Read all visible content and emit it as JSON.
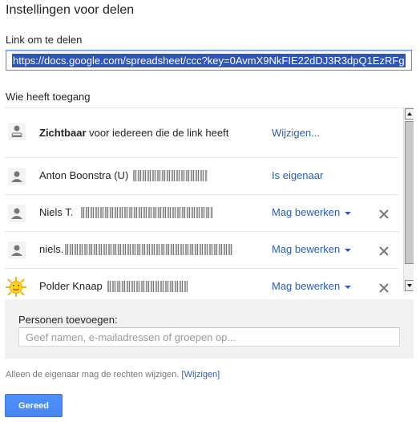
{
  "dialog": {
    "title": "Instellingen voor delen",
    "link_label": "Link om te delen",
    "link_value": "https://docs.google.com/spreadsheet/ccc?key=0AvmX9NkFIE22dDJ3R3dpQ1EzRFg",
    "access_label": "Wie heeft toegang"
  },
  "access": {
    "visibility": {
      "bold": "Zichtbaar",
      "text": " voor iedereen die de link heeft",
      "action": "Wijzigen..."
    },
    "people": [
      {
        "name": "Anton Boonstra (U)",
        "role": "Is eigenaar",
        "has_caret": false,
        "removable": false,
        "avatar": "person-icon"
      },
      {
        "name": "Niels T.",
        "role": "Mag bewerken",
        "has_caret": true,
        "removable": true,
        "avatar": "person-icon"
      },
      {
        "name": "niels.",
        "role": "Mag bewerken",
        "has_caret": true,
        "removable": true,
        "avatar": "person-icon"
      },
      {
        "name": "Polder Knaap",
        "role": "Mag bewerken",
        "has_caret": true,
        "removable": true,
        "avatar": "sun-avatar-icon"
      }
    ]
  },
  "add_people": {
    "label": "Personen toevoegen:",
    "placeholder": "Geef namen, e-mailadressen of groepen op...",
    "value": ""
  },
  "footer": {
    "note": "Alleen de eigenaar mag de rechten wijzigen.",
    "link": "[Wijzigen]"
  },
  "buttons": {
    "done": "Gereed"
  },
  "colors": {
    "link_blue": "#2a5db0",
    "primary_button": "#4d90fe",
    "selection": "#2f55b6"
  }
}
